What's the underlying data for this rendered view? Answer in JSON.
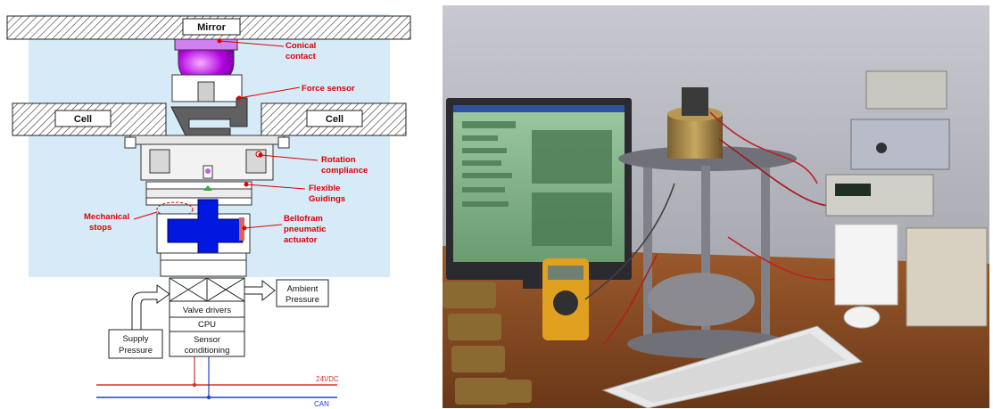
{
  "diagram": {
    "labels": {
      "mirror": "Mirror",
      "cell_left": "Cell",
      "cell_right": "Cell",
      "conical_contact_1": "Conical",
      "conical_contact_2": "contact",
      "force_sensor": "Force sensor",
      "rotation_compliance_1": "Rotation",
      "rotation_compliance_2": "compliance",
      "flexible_guidings_1": "Flexible",
      "flexible_guidings_2": "Guidings",
      "mechanical_stops_1": "Mechanical",
      "mechanical_stops_2": "stops",
      "bellofram_1": "Bellofram",
      "bellofram_2": "pneumatic",
      "bellofram_3": "actuator",
      "ambient_pressure_1": "Ambient",
      "ambient_pressure_2": "Pressure",
      "supply_pressure_1": "Supply",
      "supply_pressure_2": "Pressure",
      "valve_drivers": "Valve drivers",
      "cpu": "CPU",
      "sensor_conditioning_1": "Sensor",
      "sensor_conditioning_2": "conditioning",
      "bus_24vdc": "24VDC",
      "bus_can": "CAN"
    },
    "colors": {
      "background": "#d6eaf8",
      "bellofram": "#0018e0",
      "cone": "#b000e0",
      "label_red": "#e00000",
      "bus_power": "#e03030",
      "bus_can": "#2040d0"
    }
  },
  "photo": {
    "monitor_screen": "green-icon",
    "test_rig": "actuator-test-bench"
  }
}
